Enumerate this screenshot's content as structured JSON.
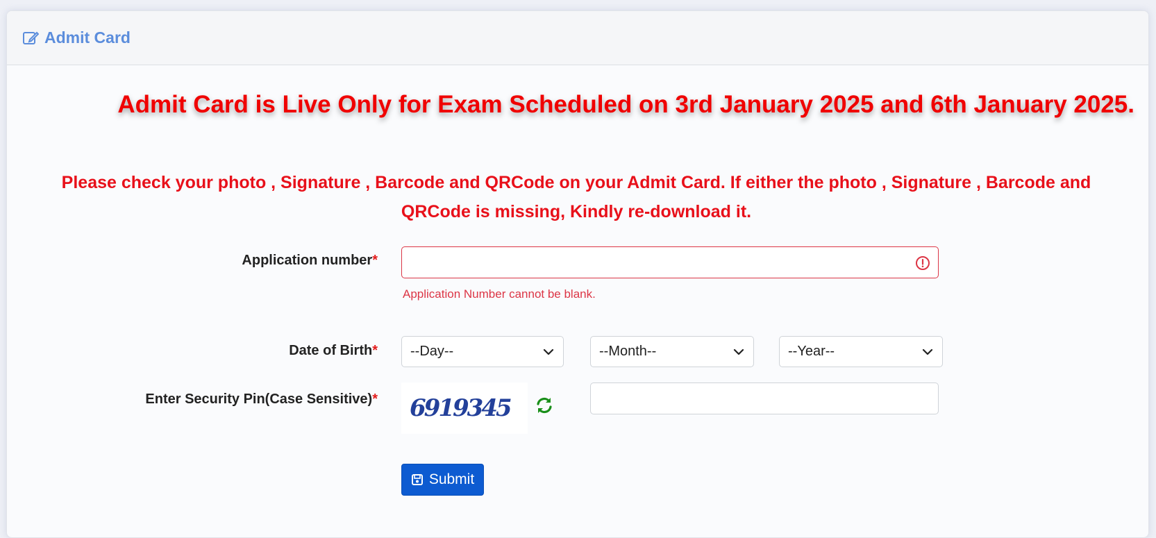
{
  "header": {
    "title": "Admit Card",
    "icon": "edit-icon"
  },
  "notices": {
    "live": "Admit Card is Live Only for Exam Scheduled on 3rd January 2025 and 6th January 2025.",
    "check": "Please check your photo , Signature , Barcode and QRCode on your Admit Card. If either the photo , Signature , Barcode and QRCode is missing, Kindly re-download it."
  },
  "form": {
    "application_label": "Application number",
    "application_value": "",
    "application_error": "Application Number cannot be blank.",
    "dob_label": "Date of Birth",
    "day_selected": "--Day--",
    "month_selected": "--Month--",
    "year_selected": "--Year--",
    "pin_label": "Enter Security Pin(Case Sensitive)",
    "captcha_text": "6919345",
    "pin_value": "",
    "required_mark": "*",
    "submit_label": "Submit"
  },
  "colors": {
    "accent": "#5b8ddc",
    "notice_red": "#f00000",
    "error": "#dc3545",
    "submit": "#0d5bd1",
    "refresh_green": "#1a8f1a"
  }
}
